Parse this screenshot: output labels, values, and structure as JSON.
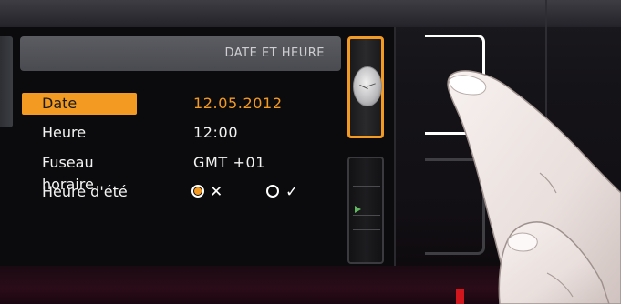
{
  "panel": {
    "title": "DATE ET HEURE"
  },
  "settings": {
    "rows": [
      {
        "label": "Date",
        "value": "12.05.2012",
        "selected": true
      },
      {
        "label": "Heure",
        "value": "12:00"
      },
      {
        "label": "Fuseau horaire",
        "value": "GMT +01"
      },
      {
        "label": "Heure d'été"
      }
    ],
    "dst_options": [
      {
        "mark": "✕",
        "selected": true
      },
      {
        "mark": "✓",
        "selected": false
      }
    ]
  },
  "side_menu": {
    "tabs": [
      {
        "icon": "clock-icon",
        "active": true
      },
      {
        "icon": "gauge-icon",
        "active": false
      }
    ]
  },
  "colors": {
    "accent": "#f39a22",
    "text": "#f4f4f4",
    "header_bg": "#515257",
    "screen_bg": "#0b0b0d"
  }
}
